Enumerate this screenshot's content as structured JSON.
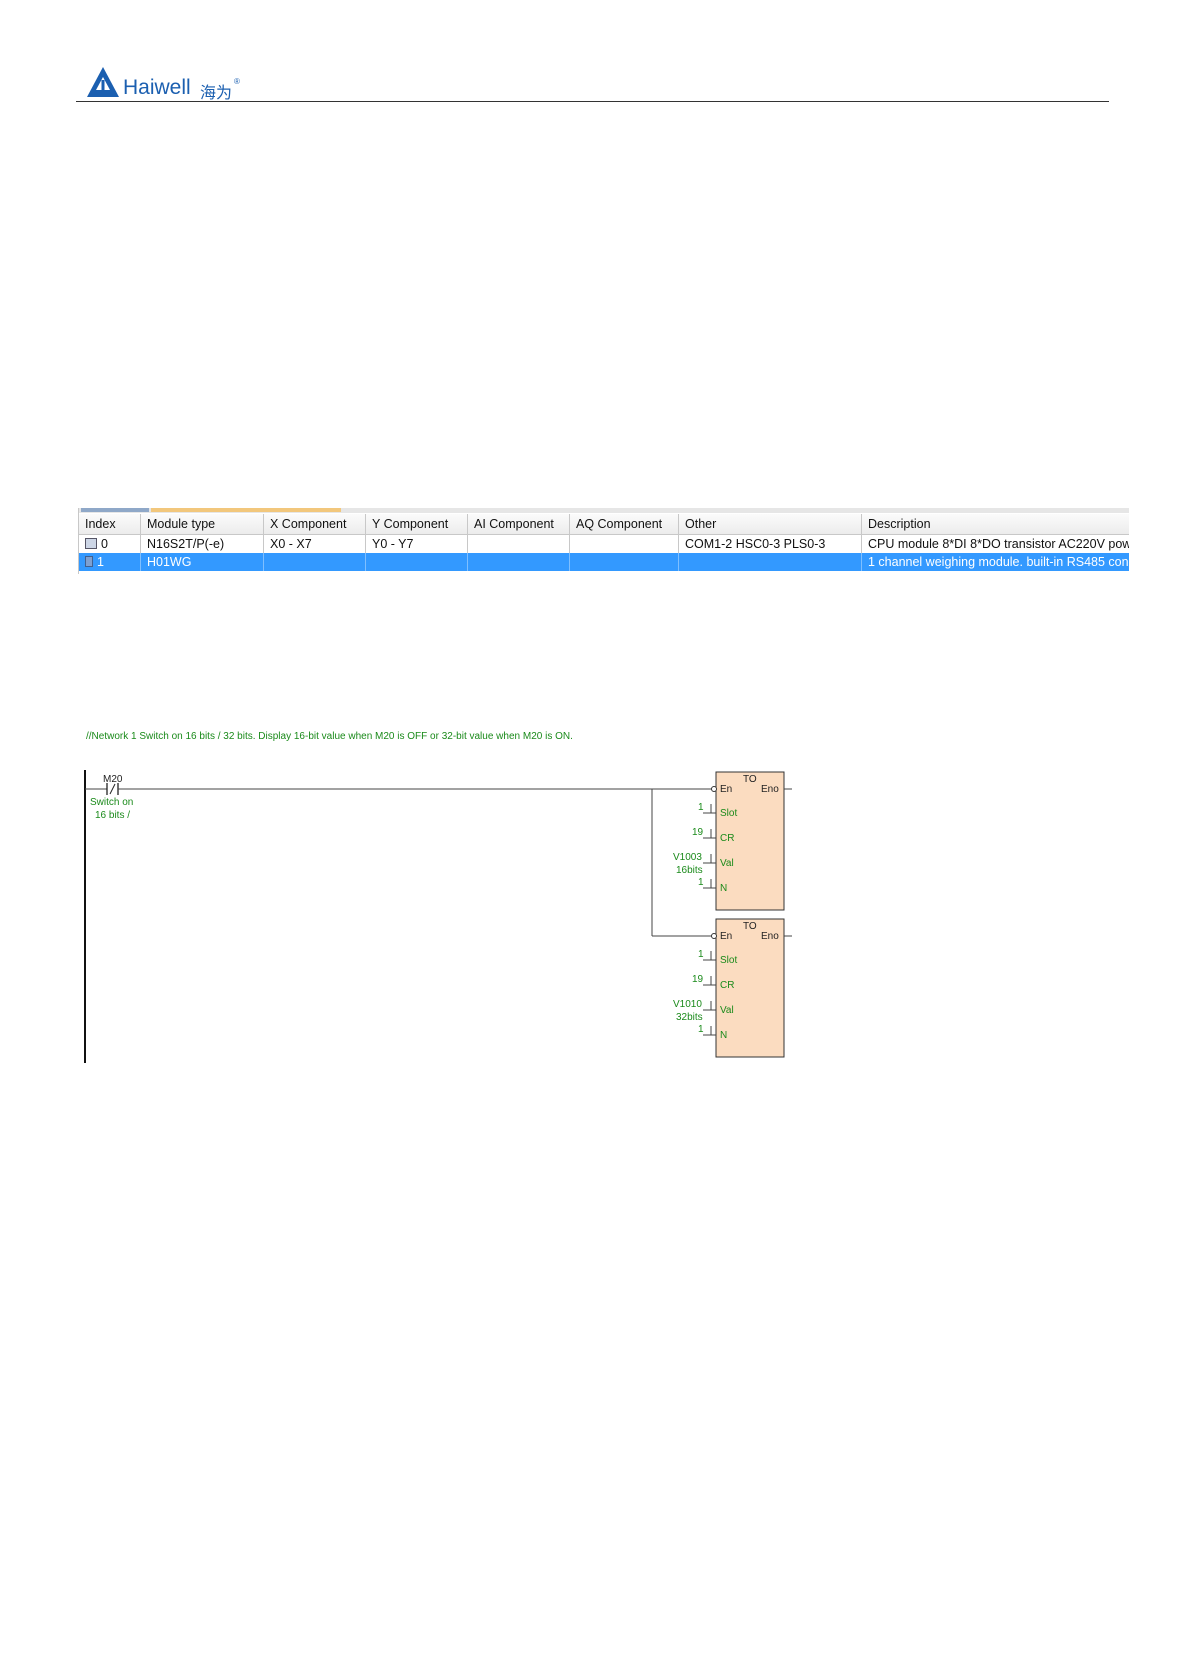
{
  "header": {
    "brand": "Haiwell",
    "brand_cn": "海为",
    "reg_mark": "®"
  },
  "colors": {
    "brand_blue": "#1b5fb0",
    "comment_green": "#1a8a1a",
    "block_fill": "#fbdcc0",
    "selected_row": "#3399ff"
  },
  "module_table": {
    "columns": [
      "Index",
      "Module type",
      "X Component",
      "Y Component",
      "AI Component",
      "AQ Component",
      "Other",
      "Description"
    ],
    "rows": [
      {
        "index": "0",
        "module_type": "N16S2T/P(-e)",
        "x_component": "X0 - X7",
        "y_component": "Y0 - Y7",
        "ai_component": "",
        "aq_component": "",
        "other": "COM1-2 HSC0-3 PLS0-3",
        "description": "CPU module 8*DI 8*DO transistor AC220V pow",
        "icon": "cpu-module-icon",
        "selected": false
      },
      {
        "index": "1",
        "module_type": "H01WG",
        "x_component": "",
        "y_component": "",
        "ai_component": "",
        "aq_component": "",
        "other": "",
        "description": "1 channel weighing module. built-in RS485 con",
        "icon": "expansion-module-icon",
        "selected": true
      }
    ]
  },
  "ladder": {
    "network_comment": "//Network 1  Switch on 16 bits / 32 bits. Display 16-bit value when M20 is OFF or 32-bit value when M20 is ON.",
    "contact": {
      "address": "M20",
      "symbol": "/",
      "comment_line1": "Switch on",
      "comment_line2": "16 bits /"
    },
    "blocks": [
      {
        "name": "TO",
        "en": "En",
        "eno": "Eno",
        "pins": [
          {
            "label": "Slot",
            "value": "1",
            "comment": ""
          },
          {
            "label": "CR",
            "value": "19",
            "comment": ""
          },
          {
            "label": "Val",
            "value": "V1003",
            "comment": "16bits"
          },
          {
            "label": "N",
            "value": "1",
            "comment": ""
          }
        ]
      },
      {
        "name": "TO",
        "en": "En",
        "eno": "Eno",
        "pins": [
          {
            "label": "Slot",
            "value": "1",
            "comment": ""
          },
          {
            "label": "CR",
            "value": "19",
            "comment": ""
          },
          {
            "label": "Val",
            "value": "V1010",
            "comment": "32bits"
          },
          {
            "label": "N",
            "value": "1",
            "comment": ""
          }
        ]
      }
    ]
  }
}
